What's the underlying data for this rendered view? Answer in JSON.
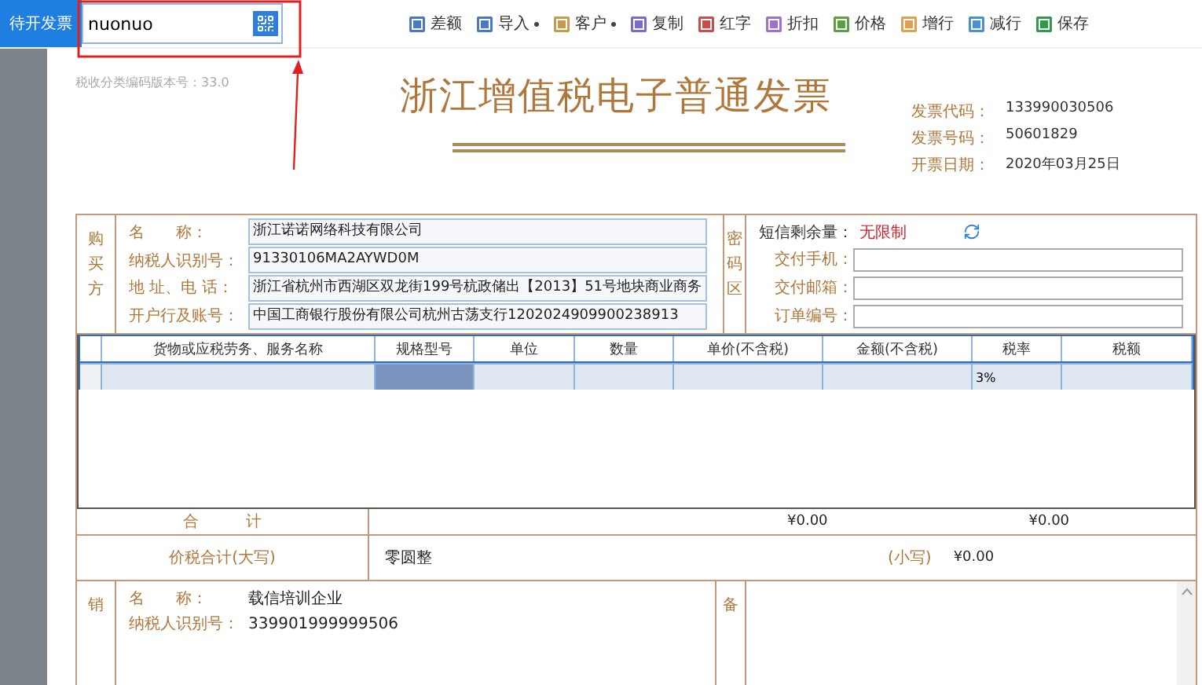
{
  "sidebar": {
    "button": "待开发票"
  },
  "search": {
    "value": "nuonuo"
  },
  "toolbar": [
    {
      "label": "差额",
      "kind": "plain",
      "color": "#4a78c8"
    },
    {
      "label": "导入",
      "kind": "dropdown",
      "color": "#4a78c8"
    },
    {
      "label": "客户",
      "kind": "dropdown",
      "color": "#c89a50"
    },
    {
      "label": "复制",
      "kind": "plain",
      "color": "#7a6ad0"
    },
    {
      "label": "红字",
      "kind": "plain",
      "color": "#d04a4a"
    },
    {
      "label": "折扣",
      "kind": "plain",
      "color": "#a070d0"
    },
    {
      "label": "价格",
      "kind": "plain",
      "color": "#5aa040"
    },
    {
      "label": "增行",
      "kind": "plain",
      "color": "#e0a050"
    },
    {
      "label": "减行",
      "kind": "plain",
      "color": "#4a90d8"
    },
    {
      "label": "保存",
      "kind": "plain",
      "color": "#2f9a4a"
    }
  ],
  "version": "税收分类编码版本号：33.0",
  "title": "浙江增值税电子普通发票",
  "meta": [
    {
      "label": "发票代码：",
      "value": "133990030506"
    },
    {
      "label": "发票号码：",
      "value": "50601829"
    },
    {
      "label": "开票日期：",
      "value": "2020年03月25日"
    }
  ],
  "buyer": {
    "side_label": "购买方",
    "fields": [
      {
        "label": "名　　称：",
        "value": "浙江诺诺网络科技有限公司"
      },
      {
        "label": "纳税人识别号：",
        "value": "91330106MA2AYWD0M"
      },
      {
        "label": "地 址、电 话：",
        "value": "浙江省杭州市西湖区双龙街199号杭政储出【2013】51号地块商业商务"
      },
      {
        "label": "开户行及账号：",
        "value": "中国工商银行股份有限公司杭州古荡支行1202024909900238913"
      }
    ]
  },
  "cipher_label": "密码区",
  "sms": {
    "label": "短信剩余量：",
    "value": "无限制"
  },
  "delivery": [
    {
      "label": "交付手机："
    },
    {
      "label": "交付邮箱："
    },
    {
      "label": "订单编号："
    }
  ],
  "goods": {
    "columns": [
      "货物或应税劳务、服务名称",
      "规格型号",
      "单位",
      "数量",
      "单价(不含税)",
      "金额(不含税)",
      "税率",
      "税额"
    ],
    "rows": [
      {
        "cells": [
          {
            "selected": false
          },
          {
            "selected": true
          },
          {
            "selected": false
          },
          {
            "selected": false
          },
          {
            "selected": false
          },
          {
            "selected": false
          },
          {
            "text": "3%",
            "selected": false
          },
          {
            "selected": false
          }
        ]
      }
    ]
  },
  "total": {
    "label": "合　　　计",
    "amount": "¥0.00",
    "tax": "¥0.00"
  },
  "grand_total": {
    "label": "价税合计(大写)",
    "words": "零圆整",
    "small_label": "(小写)",
    "amount": "¥0.00"
  },
  "seller": {
    "side_label": "销",
    "fields": [
      {
        "label": "名　　称：",
        "value": "载信培训企业"
      },
      {
        "label": "纳税人识别号：",
        "value": "339901999999506"
      }
    ]
  },
  "remarks_label": "备"
}
